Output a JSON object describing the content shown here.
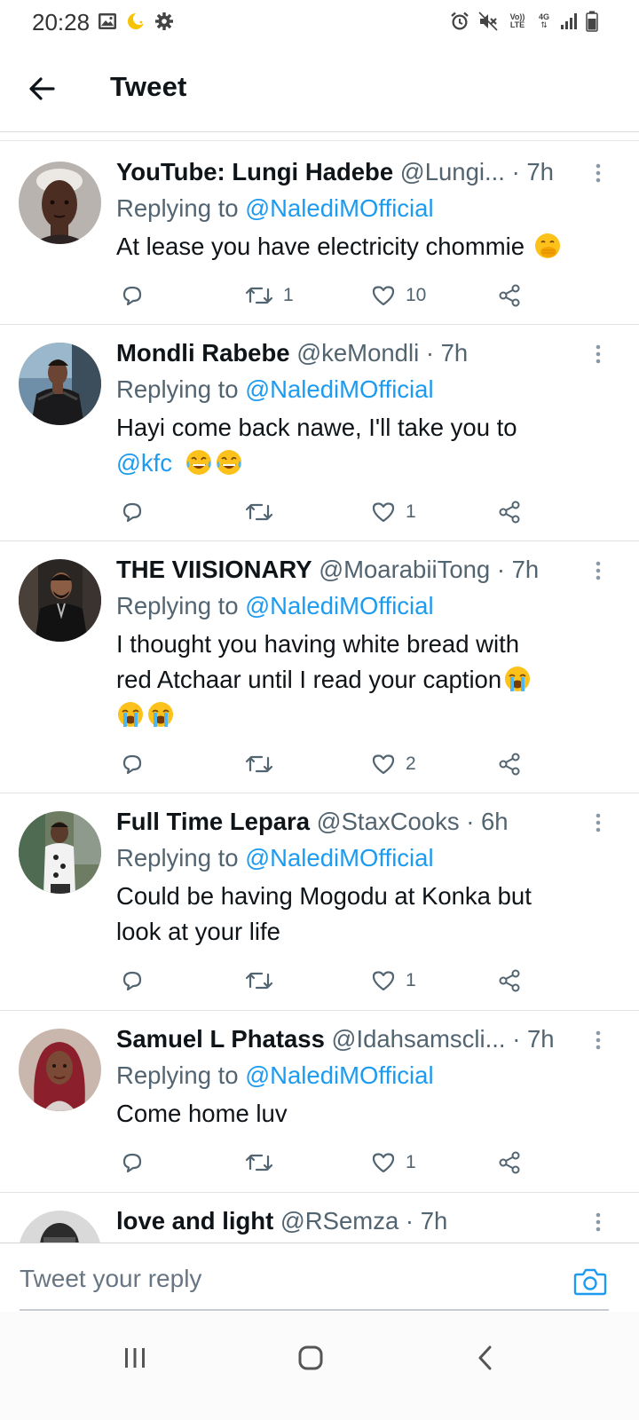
{
  "status_bar": {
    "time": "20:28",
    "volte_label": "Vo)) LTE",
    "network_label": "4G",
    "left_icons": [
      "gallery-icon",
      "moon-icon",
      "gear-icon"
    ],
    "right_icons": [
      "alarm-icon",
      "mute-icon",
      "volte-icon",
      "network-4g-icon",
      "signal-icon",
      "battery-icon"
    ]
  },
  "header": {
    "title": "Tweet",
    "back_icon": "arrow-left-icon"
  },
  "colors": {
    "accent": "#1d9bf0",
    "text": "#0f1419",
    "muted": "#536471"
  },
  "tweets": [
    {
      "name": "YouTube: Lungi Hadebe",
      "handle": "@Lungi...",
      "time": "· 7h",
      "replying_prefix": "Replying to ",
      "replying_to": "@NalediMOfficial",
      "text": "At lease you have electricity chommie",
      "emojis": [
        "face-with-hand-over-mouth"
      ],
      "retweets": "1",
      "likes": "10"
    },
    {
      "name": "Mondli Rabebe",
      "handle": "@keMondli",
      "time": "· 7h",
      "replying_prefix": "Replying to ",
      "replying_to": "@NalediMOfficial",
      "text_line1": "Hayi come back nawe, I'll take you to",
      "text_mention": "@kfc",
      "emojis": [
        "tears-of-joy",
        "tears-of-joy"
      ],
      "retweets": "",
      "likes": "1"
    },
    {
      "name": "THE VIISIONARY",
      "handle": "@MoarabiiTong",
      "time": "· 7h",
      "replying_prefix": "Replying to ",
      "replying_to": "@NalediMOfficial",
      "text_line1": "I thought  you having white bread with",
      "text_line2": "red Atchaar until  I read your caption",
      "emojis": [
        "loudly-crying",
        "loudly-crying",
        "loudly-crying"
      ],
      "retweets": "",
      "likes": "2"
    },
    {
      "name": "Full Time Lepara",
      "handle": "@StaxCooks",
      "time": "· 6h",
      "replying_prefix": "Replying to ",
      "replying_to": "@NalediMOfficial",
      "text_line1": "Could be having Mogodu at Konka but",
      "text_line2": "look at your life",
      "retweets": "",
      "likes": "1"
    },
    {
      "name": "Samuel L Phatass",
      "handle": "@Idahsamscli...",
      "time": "· 7h",
      "replying_prefix": "Replying to ",
      "replying_to": "@NalediMOfficial",
      "text": "Come home luv",
      "retweets": "",
      "likes": "1"
    },
    {
      "name": "love and light",
      "handle": "@RSemza",
      "time": "· 7h"
    }
  ],
  "reply_bar": {
    "placeholder": "Tweet your reply",
    "camera_icon": "camera-icon"
  },
  "nav_bar": {
    "buttons": [
      "recent-apps-icon",
      "home-icon",
      "back-icon"
    ]
  }
}
